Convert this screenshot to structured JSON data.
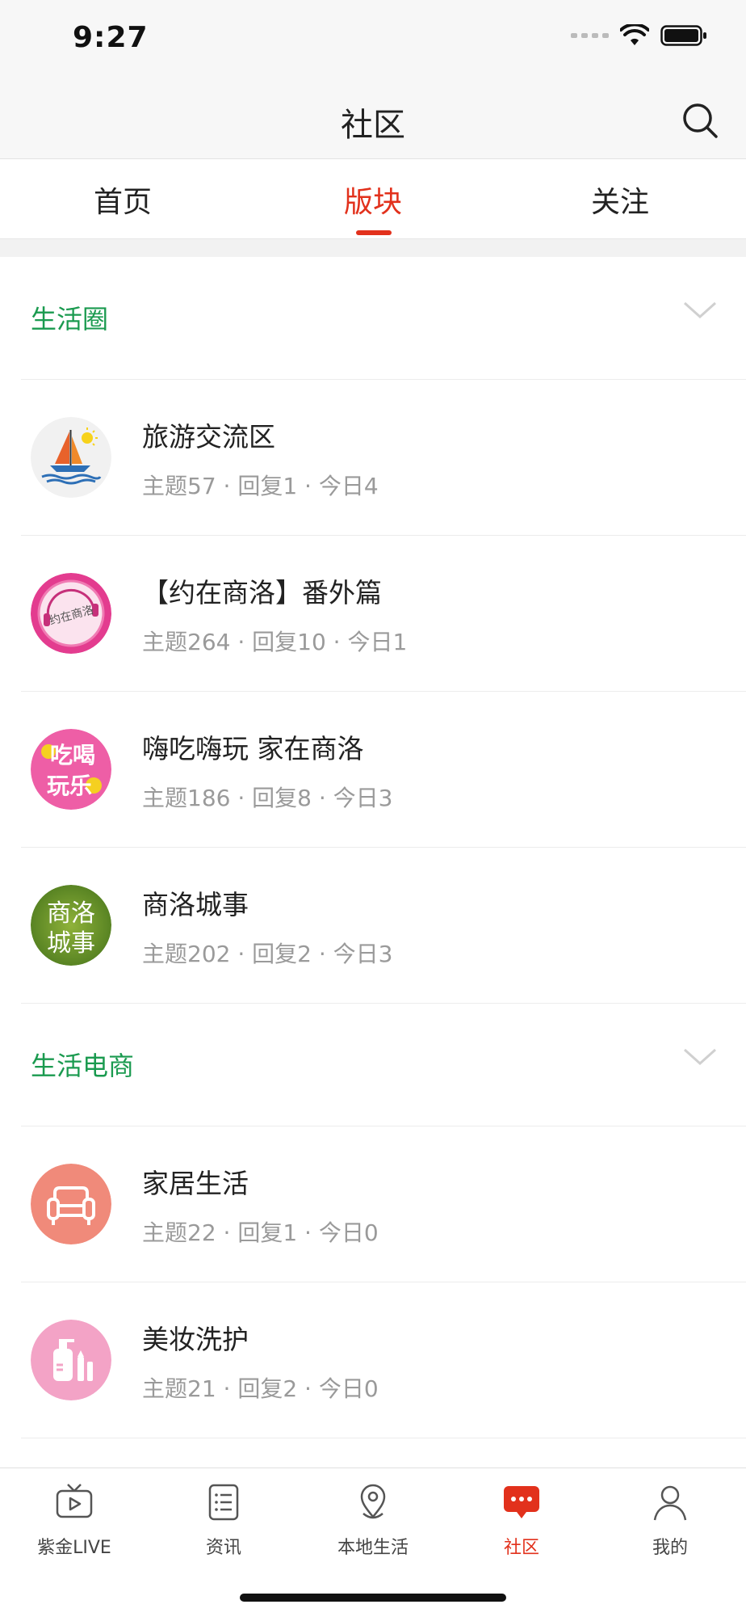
{
  "status": {
    "time": "9:27"
  },
  "nav": {
    "title": "社区"
  },
  "tabs": [
    {
      "label": "首页"
    },
    {
      "label": "版块"
    },
    {
      "label": "关注"
    }
  ],
  "active_tab": "版块",
  "sections": [
    {
      "title": "生活圈",
      "items": [
        {
          "name": "旅游交流区",
          "meta": "主题57 · 回复1 · 今日4",
          "icon": "sailboat-icon"
        },
        {
          "name": "【约在商洛】番外篇",
          "meta": "主题264 · 回复10 · 今日1",
          "icon": "meet-shangluo-icon"
        },
        {
          "name": "嗨吃嗨玩 家在商洛",
          "meta": "主题186 · 回复8 · 今日3",
          "icon": "eat-drink-play-icon"
        },
        {
          "name": "商洛城事",
          "meta": "主题202 · 回复2 · 今日3",
          "icon": "city-affairs-icon"
        }
      ]
    },
    {
      "title": "生活电商",
      "items": [
        {
          "name": "家居生活",
          "meta": "主题22 · 回复1 · 今日0",
          "icon": "sofa-icon"
        },
        {
          "name": "美妆洗护",
          "meta": "主题21 · 回复2 · 今日0",
          "icon": "cosmetics-icon"
        }
      ]
    }
  ],
  "avatar_text": {
    "meet": "约在商洛",
    "eat": [
      "吃喝",
      "玩乐"
    ],
    "city": [
      "商洛",
      "城事"
    ]
  },
  "tabbar": [
    {
      "label": "紫金LIVE",
      "icon": "tv-icon"
    },
    {
      "label": "资讯",
      "icon": "list-icon"
    },
    {
      "label": "本地生活",
      "icon": "location-icon"
    },
    {
      "label": "社区",
      "icon": "chat-bubble-icon"
    },
    {
      "label": "我的",
      "icon": "user-icon"
    }
  ],
  "colors": {
    "accent": "#e2311c",
    "section_green": "#1a9a4f",
    "meta_gray": "#9a9a9a"
  }
}
